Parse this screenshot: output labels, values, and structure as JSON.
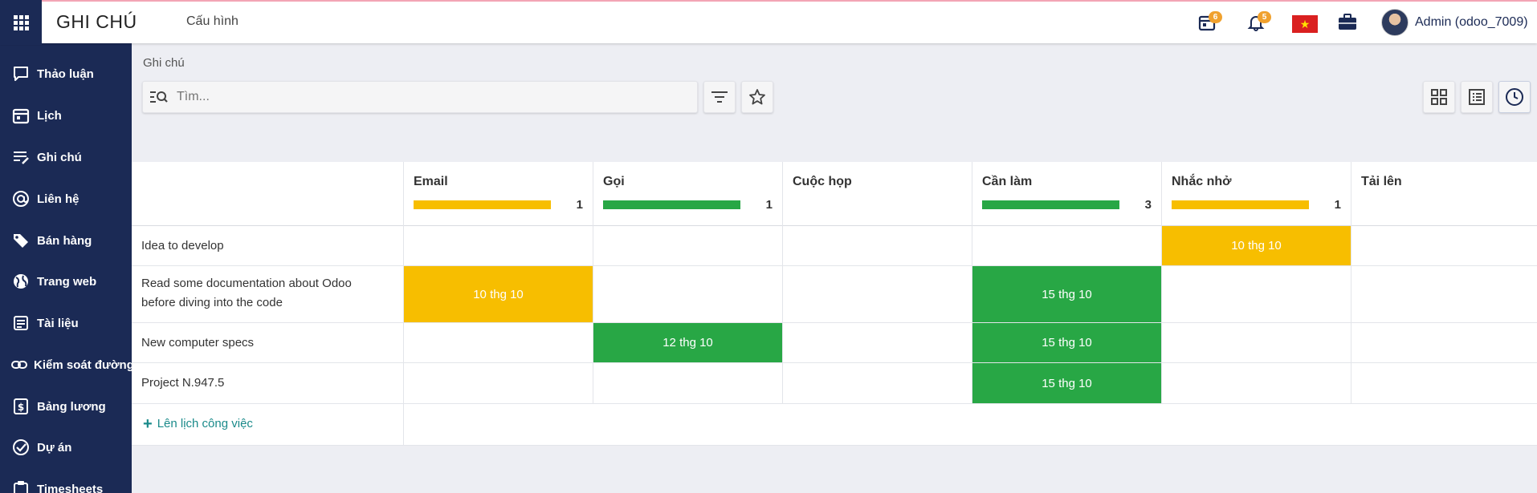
{
  "topbar": {
    "app_title": "GHI CHÚ",
    "menu_config": "Cấu hình",
    "activity_count": "6",
    "notification_count": "5",
    "user_name": "Admin (odoo_7009)"
  },
  "sidebar": {
    "items": [
      {
        "label": "Thảo luận",
        "icon": "chat-icon"
      },
      {
        "label": "Lịch",
        "icon": "calendar-icon"
      },
      {
        "label": "Ghi chú",
        "icon": "note-icon"
      },
      {
        "label": "Liên hệ",
        "icon": "at-sign-icon"
      },
      {
        "label": "Bán hàng",
        "icon": "tag-icon"
      },
      {
        "label": "Trang web",
        "icon": "globe-icon"
      },
      {
        "label": "Tài liệu",
        "icon": "document-icon"
      },
      {
        "label": "Kiểm soát đường",
        "icon": "link-icon"
      },
      {
        "label": "Bảng lương",
        "icon": "payroll-icon"
      },
      {
        "label": "Dự án",
        "icon": "check-circle-icon"
      },
      {
        "label": "Timesheets",
        "icon": "clipboard-icon"
      }
    ]
  },
  "control_panel": {
    "breadcrumb": "Ghi chú",
    "search_placeholder": "Tìm..."
  },
  "grid": {
    "columns": [
      {
        "title": "Email",
        "count": "1",
        "bar_color": "#f7be00",
        "progress": 1.0
      },
      {
        "title": "Gọi",
        "count": "1",
        "bar_color": "#28a745",
        "progress": 1.0
      },
      {
        "title": "Cuộc họp",
        "count": "",
        "bar_color": "",
        "progress": 0
      },
      {
        "title": "Cần làm",
        "count": "3",
        "bar_color": "#28a745",
        "progress": 1.0
      },
      {
        "title": "Nhắc nhở",
        "count": "1",
        "bar_color": "#f7be00",
        "progress": 1.0
      },
      {
        "title": "Tải lên",
        "count": "",
        "bar_color": "",
        "progress": 0
      }
    ],
    "rows": [
      {
        "label": "Idea to develop",
        "cells": [
          "",
          "",
          "",
          "",
          "10 thg 10",
          ""
        ]
      },
      {
        "label": "Read some documentation about Odoo before diving into the code",
        "cells": [
          "10 thg 10",
          "",
          "",
          "15 thg 10",
          "",
          ""
        ]
      },
      {
        "label": "New computer specs",
        "cells": [
          "",
          "12 thg 10",
          "",
          "15 thg 10",
          "",
          ""
        ]
      },
      {
        "label": "Project N.947.5",
        "cells": [
          "",
          "",
          "",
          "15 thg 10",
          "",
          ""
        ]
      }
    ],
    "cell_colors": {
      "10 thg 10": "#f7be00",
      "12 thg 10": "#28a745",
      "15 thg 10": "#28a745"
    },
    "add_link": "Lên lịch công việc"
  }
}
